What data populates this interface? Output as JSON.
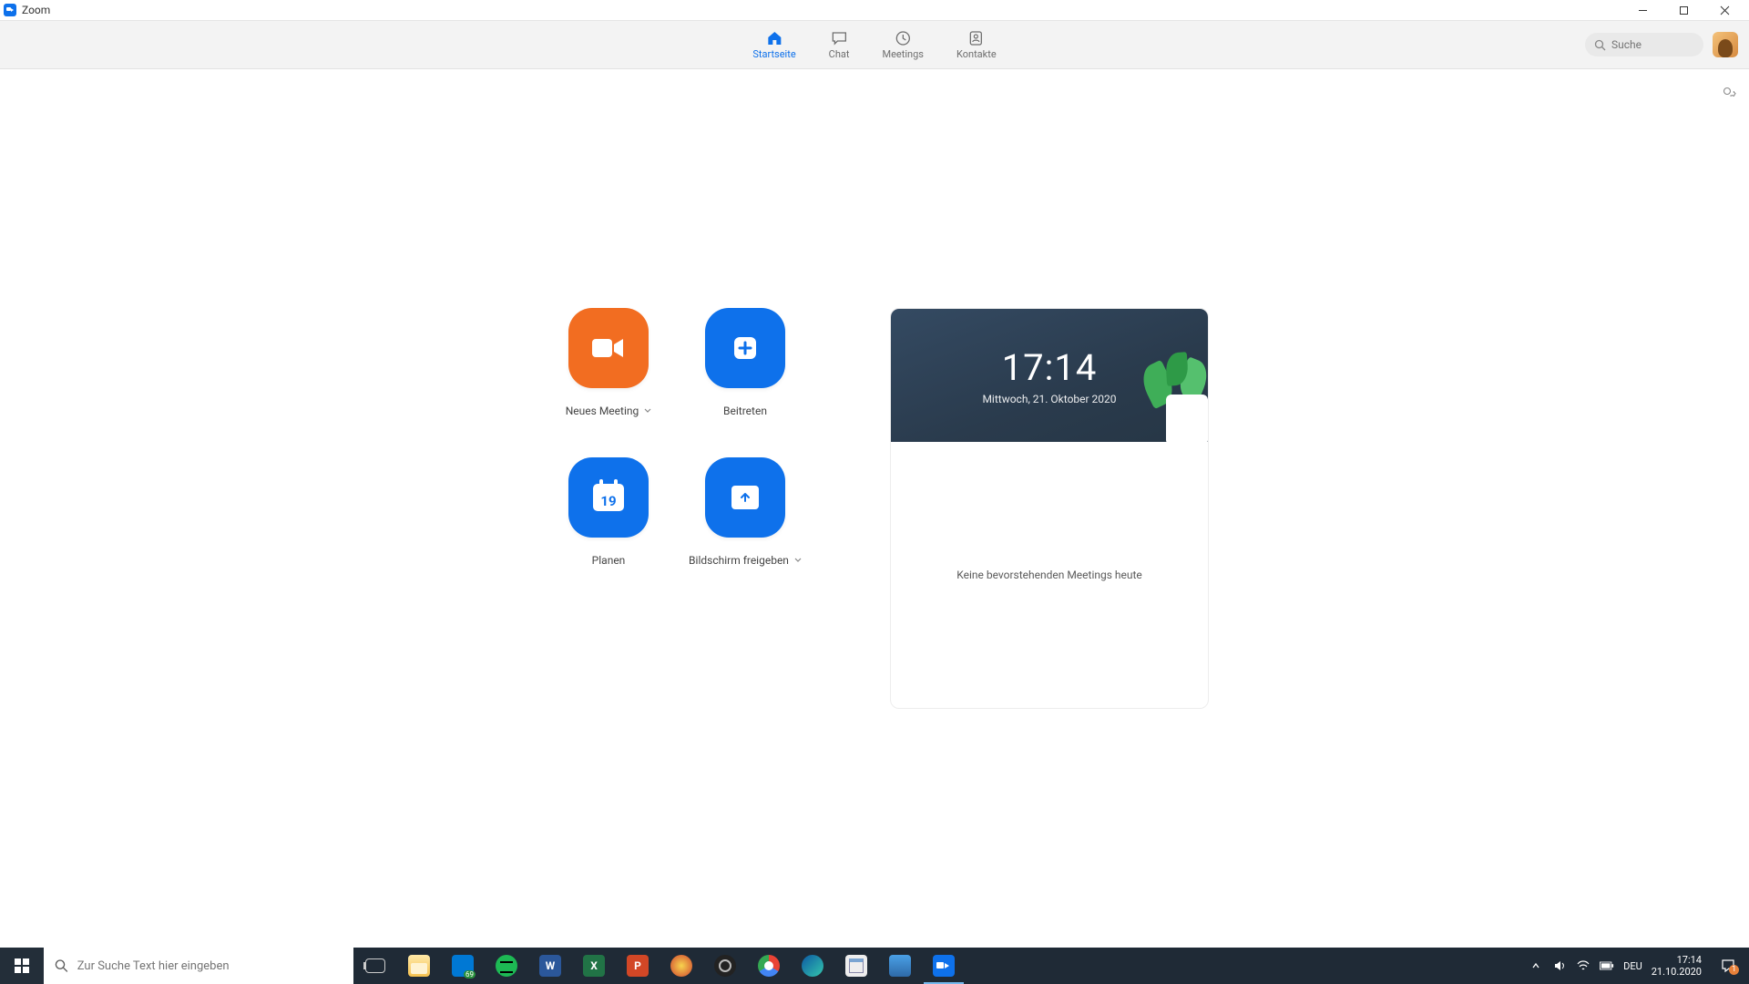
{
  "titlebar": {
    "title": "Zoom"
  },
  "nav": {
    "tabs": [
      {
        "label": "Startseite",
        "icon": "home",
        "active": true
      },
      {
        "label": "Chat",
        "icon": "chat",
        "active": false
      },
      {
        "label": "Meetings",
        "icon": "clock",
        "active": false
      },
      {
        "label": "Kontakte",
        "icon": "contacts",
        "active": false
      }
    ],
    "search_placeholder": "Suche"
  },
  "home": {
    "actions": {
      "new_meeting": "Neues Meeting",
      "join": "Beitreten",
      "schedule": "Planen",
      "schedule_day": "19",
      "share": "Bildschirm freigeben"
    },
    "clock": {
      "time": "17:14",
      "date": "Mittwoch, 21. Oktober 2020",
      "empty": "Keine bevorstehenden Meetings heute"
    }
  },
  "taskbar": {
    "search_placeholder": "Zur Suche Text hier eingeben",
    "apps": [
      {
        "name": "task-view",
        "cls": "taskview"
      },
      {
        "name": "file-explorer",
        "cls": "c-explorer"
      },
      {
        "name": "mail",
        "cls": "c-mail"
      },
      {
        "name": "spotify",
        "cls": "c-spotify"
      },
      {
        "name": "word",
        "cls": "c-word",
        "letter": "W"
      },
      {
        "name": "excel",
        "cls": "c-excel",
        "letter": "X"
      },
      {
        "name": "powerpoint",
        "cls": "c-ppt",
        "letter": "P"
      },
      {
        "name": "app-misc",
        "cls": "c-misc1"
      },
      {
        "name": "obs",
        "cls": "c-obs"
      },
      {
        "name": "chrome",
        "cls": "c-chrome"
      },
      {
        "name": "edge",
        "cls": "c-edge"
      },
      {
        "name": "notepad",
        "cls": "c-np"
      },
      {
        "name": "photos",
        "cls": "c-photos"
      },
      {
        "name": "zoom",
        "cls": "c-zoom",
        "active": true
      }
    ],
    "lang": "DEU",
    "time": "17:14",
    "date": "21.10.2020",
    "notif_count": "1"
  }
}
